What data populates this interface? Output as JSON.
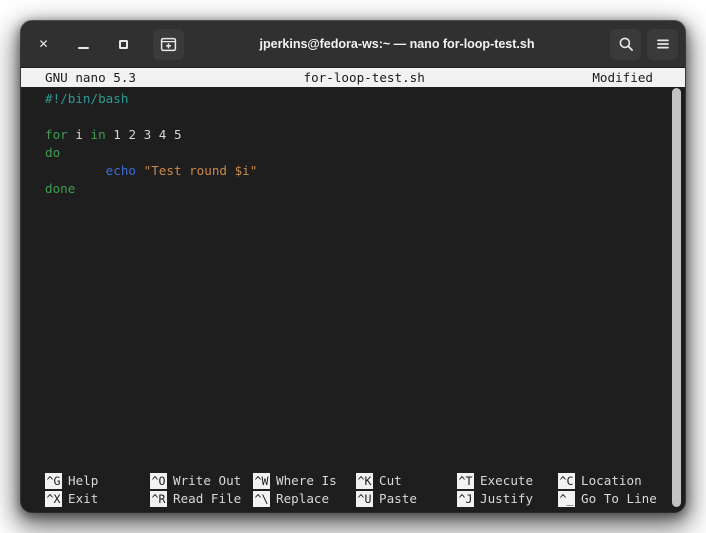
{
  "window": {
    "title": "jperkins@fedora-ws:~ — nano for-loop-test.sh",
    "controls": {
      "close_label": "Close",
      "minimize_label": "Minimize",
      "maximize_label": "Maximize",
      "new_terminal_label": "New Terminal",
      "search_label": "Search",
      "menu_label": "Main Menu"
    },
    "colors": {
      "titlebar_bg": "#303030",
      "terminal_bg": "#1e1e1e",
      "reverse_bg": "#f2f2f2",
      "scrollbar": "#c3c3c3"
    }
  },
  "nano": {
    "version": "GNU nano 5.3",
    "filename": "for-loop-test.sh",
    "status": "Modified",
    "buffer": [
      {
        "tokens": [
          {
            "text": "#!/bin/bash",
            "type": "comment"
          }
        ]
      },
      {
        "tokens": []
      },
      {
        "tokens": [
          {
            "text": "for",
            "type": "keyword"
          },
          {
            "text": " ",
            "type": "plain"
          },
          {
            "text": "i",
            "type": "plain"
          },
          {
            "text": " ",
            "type": "plain"
          },
          {
            "text": "in",
            "type": "keyword"
          },
          {
            "text": " 1 2 3 4 5",
            "type": "plain"
          }
        ]
      },
      {
        "tokens": [
          {
            "text": "do",
            "type": "keyword"
          }
        ]
      },
      {
        "tokens": [
          {
            "text": "        ",
            "type": "plain"
          },
          {
            "text": "echo",
            "type": "builtin"
          },
          {
            "text": " ",
            "type": "plain"
          },
          {
            "text": "\"Test round $i\"",
            "type": "string"
          }
        ]
      },
      {
        "tokens": [
          {
            "text": "done",
            "type": "keyword"
          }
        ]
      }
    ],
    "shortcut_columns": [
      {
        "rows": [
          {
            "key": "^G",
            "label": "Help"
          },
          {
            "key": "^X",
            "label": "Exit"
          }
        ]
      },
      {
        "rows": [
          {
            "key": "^O",
            "label": "Write Out"
          },
          {
            "key": "^R",
            "label": "Read File"
          }
        ]
      },
      {
        "rows": [
          {
            "key": "^W",
            "label": "Where Is"
          },
          {
            "key": "^\\",
            "label": "Replace"
          }
        ]
      },
      {
        "rows": [
          {
            "key": "^K",
            "label": "Cut"
          },
          {
            "key": "^U",
            "label": "Paste"
          }
        ]
      },
      {
        "rows": [
          {
            "key": "^T",
            "label": "Execute"
          },
          {
            "key": "^J",
            "label": "Justify"
          }
        ]
      },
      {
        "rows": [
          {
            "key": "^C",
            "label": "Location"
          },
          {
            "key": "^_",
            "label": "Go To Line"
          }
        ]
      }
    ]
  }
}
